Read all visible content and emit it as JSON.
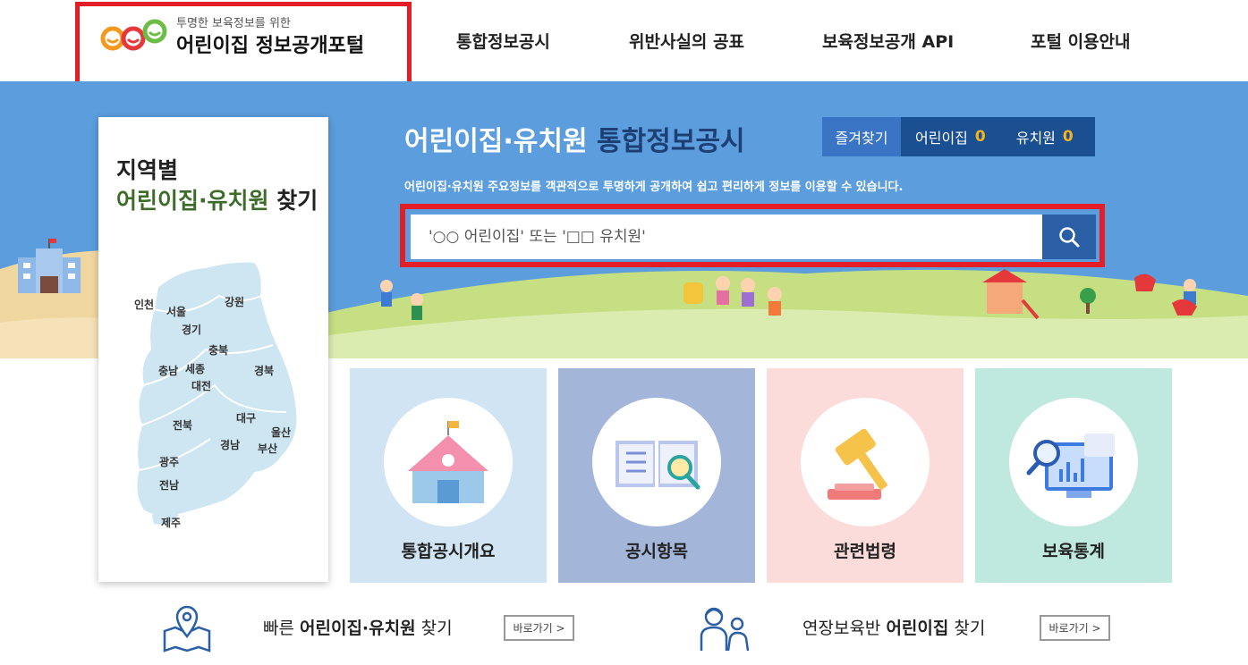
{
  "header": {
    "logo_sub": "투명한 보육정보를 위한",
    "logo_main": "어린이집 정보공개포털",
    "nav": [
      {
        "label": "통합정보공시"
      },
      {
        "label": "위반사실의 공표"
      },
      {
        "label": "보육정보공개 API"
      },
      {
        "label": "포털 이용안내"
      }
    ]
  },
  "region": {
    "title1": "지역별",
    "title2_green": "어린이집·유치원",
    "title2_rest": " 찾기",
    "regions": [
      "인천",
      "서울",
      "경기",
      "강원",
      "충북",
      "충남",
      "세종",
      "대전",
      "경북",
      "전북",
      "대구",
      "울산",
      "경남",
      "부산",
      "광주",
      "전남",
      "제주"
    ]
  },
  "hero": {
    "title_white": "어린이집·유치원",
    "title_navy": " 통합정보공시",
    "desc": "어린이집·유치원 주요정보를 객관적으로 투명하게 공개하여 쉽고 편리하게 정보를 이용할 수 있습니다.",
    "favorites": {
      "label": "즐겨찾기",
      "daycare_label": "어린이집",
      "daycare_count": "0",
      "kinder_label": "유치원",
      "kinder_count": "0"
    },
    "search": {
      "placeholder": "'○○ 어린이집' 또는 '□□ 유치원'"
    }
  },
  "cards": [
    {
      "label": "통합공시개요",
      "bg": "#d1e4f3",
      "icon": "school-building-icon"
    },
    {
      "label": "공시항목",
      "bg": "#a3b6d9",
      "icon": "open-book-magnifier-icon"
    },
    {
      "label": "관련법령",
      "bg": "#fcdcdb",
      "icon": "gavel-icon"
    },
    {
      "label": "보육통계",
      "bg": "#bfe9df",
      "icon": "statistics-monitor-icon"
    }
  ],
  "quick": [
    {
      "pre": "빠른 ",
      "bold": "어린이집·유치원",
      "post": " 찾기",
      "button": "바로가기 >",
      "icon": "location-map-icon"
    },
    {
      "pre": "연장보육반 ",
      "bold": "어린이집",
      "post": " 찾기",
      "button": "바로가기 >",
      "icon": "teacher-child-icon"
    }
  ],
  "colors": {
    "hero_bg": "#5b9ddd",
    "accent_red": "#e41e26",
    "navy": "#1a4f91",
    "count_yellow": "#f7b41b"
  }
}
